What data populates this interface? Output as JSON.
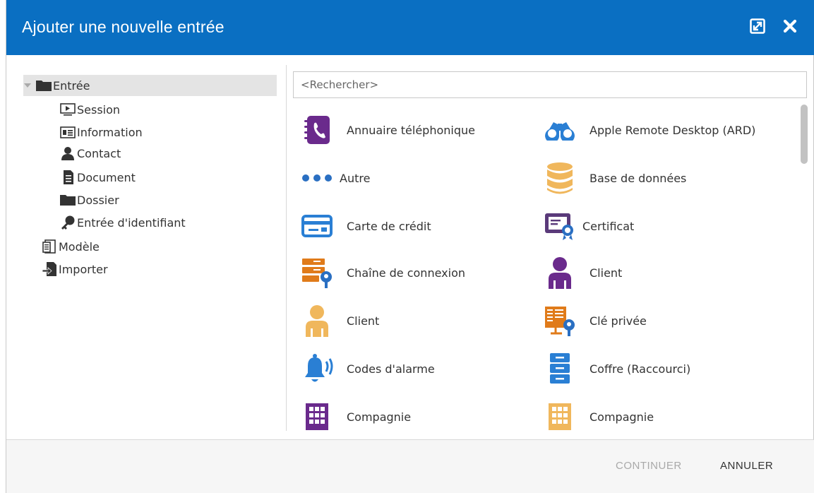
{
  "dialog": {
    "title": "Ajouter une nouvelle entrée",
    "maximize_icon": "maximize-icon",
    "close_icon": "close-icon",
    "title_bar_color": "#0a6fc2"
  },
  "tree": {
    "items": [
      {
        "label": "Entrée",
        "icon": "folder-icon",
        "expanded": true,
        "selected": true
      },
      {
        "label": "Session",
        "icon": "session-icon"
      },
      {
        "label": "Information",
        "icon": "information-card-icon"
      },
      {
        "label": "Contact",
        "icon": "contact-icon"
      },
      {
        "label": "Document",
        "icon": "document-icon"
      },
      {
        "label": "Dossier",
        "icon": "folder-icon"
      },
      {
        "label": "Entrée d'identifiant",
        "icon": "key-icon"
      },
      {
        "label": "Modèle",
        "icon": "template-icon"
      },
      {
        "label": "Importer",
        "icon": "import-icon"
      }
    ]
  },
  "search": {
    "placeholder": "<Rechercher>",
    "value": ""
  },
  "entries": [
    {
      "label": "Annuaire téléphonique",
      "icon": "phonebook-icon",
      "color": "#6a2a8c"
    },
    {
      "label": "Apple Remote Desktop (ARD)",
      "icon": "binoculars-icon",
      "color": "#2a7fd4"
    },
    {
      "label": "Autre",
      "icon": "ellipsis-icon",
      "color": "#2a6fc2"
    },
    {
      "label": "Base de données",
      "icon": "database-icon",
      "color": "#f0b75c"
    },
    {
      "label": "Carte de crédit",
      "icon": "credit-card-icon",
      "color": "#2a7fd4"
    },
    {
      "label": "Certificat",
      "icon": "certificate-icon",
      "color": "#5a3a7a"
    },
    {
      "label": "Chaîne de connexion",
      "icon": "connection-string-icon",
      "color": "#e07b1a"
    },
    {
      "label": "Client",
      "icon": "customer-icon",
      "color": "#6a2a8c"
    },
    {
      "label": "Client",
      "icon": "customer-icon",
      "color": "#f0b75c"
    },
    {
      "label": "Clé privée",
      "icon": "private-key-icon",
      "color": "#e07b1a"
    },
    {
      "label": "Codes d'alarme",
      "icon": "alarm-icon",
      "color": "#2a7fd4"
    },
    {
      "label": "Coffre (Raccourci)",
      "icon": "vault-shortcut-icon",
      "color": "#2a7fd4"
    },
    {
      "label": "Compagnie",
      "icon": "company-icon",
      "color": "#6a2a8c"
    },
    {
      "label": "Compagnie",
      "icon": "company-icon",
      "color": "#f0b75c"
    }
  ],
  "footer": {
    "continue_label": "CONTINUER",
    "cancel_label": "ANNULER"
  }
}
